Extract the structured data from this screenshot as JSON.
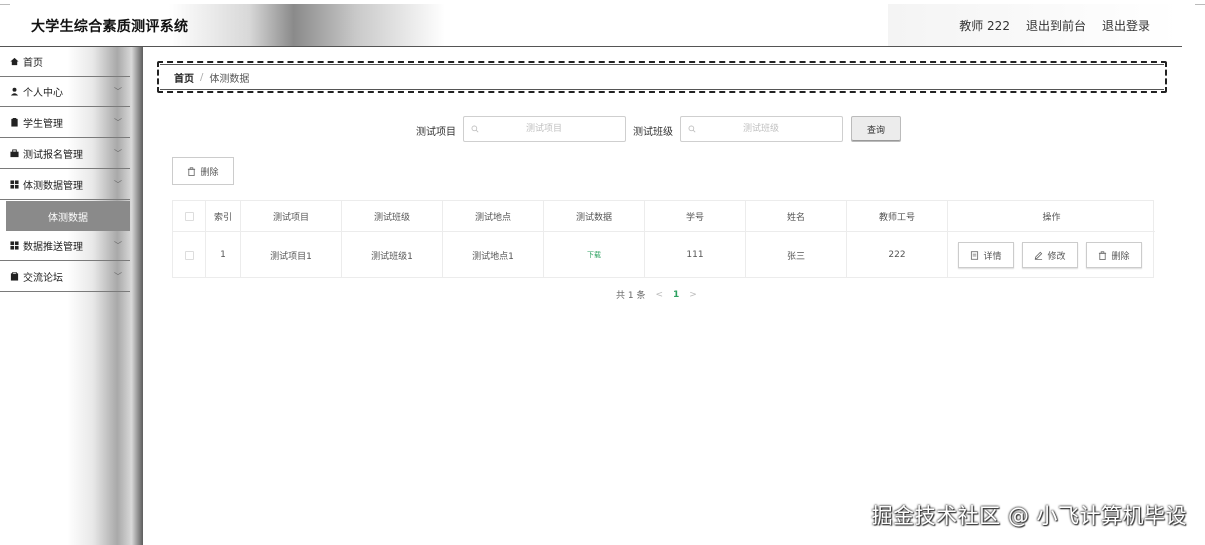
{
  "app": {
    "title": "大学生综合素质测评系统",
    "user_label": "教师 222",
    "exit_front_label": "退出到前台",
    "logout_label": "退出登录"
  },
  "sidebar": {
    "items": [
      {
        "label": "首页",
        "icon": "home-icon",
        "expandable": false
      },
      {
        "label": "个人中心",
        "icon": "user-icon",
        "expandable": true
      },
      {
        "label": "学生管理",
        "icon": "document-icon",
        "expandable": true
      },
      {
        "label": "测试报名管理",
        "icon": "briefcase-icon",
        "expandable": true
      },
      {
        "label": "体测数据管理",
        "icon": "grid-icon",
        "expandable": true
      },
      {
        "label": "数据推送管理",
        "icon": "grid-icon",
        "expandable": true
      },
      {
        "label": "交流论坛",
        "icon": "clipboard-icon",
        "expandable": true
      }
    ],
    "active_sub": "体测数据"
  },
  "breadcrumb": {
    "home": "首页",
    "separator": "/",
    "current": "体测数据"
  },
  "search": {
    "item_label": "测试项目",
    "item_placeholder": "测试项目",
    "class_label": "测试班级",
    "class_placeholder": "测试班级",
    "query_label": "查询"
  },
  "toolbar": {
    "delete_label": "删除"
  },
  "table": {
    "headers": [
      "索引",
      "测试项目",
      "测试班级",
      "测试地点",
      "测试数据",
      "学号",
      "姓名",
      "教师工号",
      "操作"
    ],
    "rows": [
      {
        "index": "1",
        "item": "测试项目1",
        "class": "测试班级1",
        "place": "测试地点1",
        "data_link": "下载",
        "student_no": "111",
        "name": "张三",
        "teacher_no": "222"
      }
    ],
    "actions": {
      "detail": "详情",
      "edit": "修改",
      "delete": "删除"
    }
  },
  "pagination": {
    "total_text": "共 1 条",
    "prev": "<",
    "current_page": "1",
    "next": ">"
  },
  "watermark": "掘金技术社区 @ 小飞计算机毕设",
  "colors": {
    "accent_green": "#2da160",
    "sidebar_active_bg": "#8a8a8a"
  }
}
